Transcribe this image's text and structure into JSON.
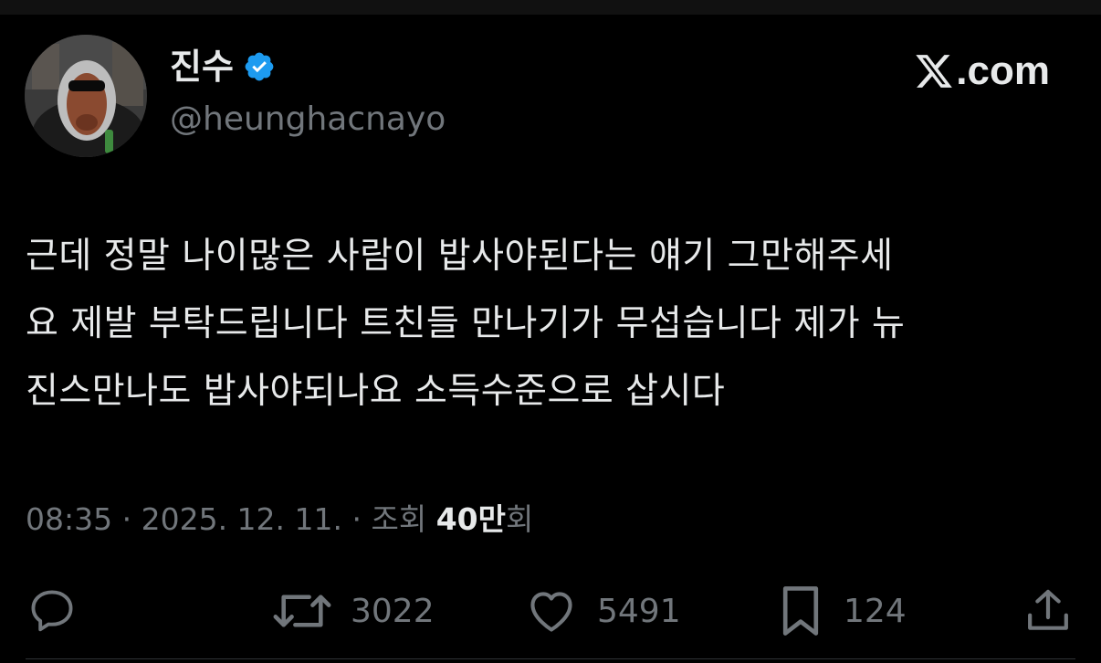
{
  "author": {
    "display_name": "진수",
    "handle": "@heunghacnayo",
    "verified": true
  },
  "brand": {
    "text": ".com"
  },
  "tweet": {
    "lines": [
      "근데 정말 나이많은 사람이 밥사야된다는 얘기 그만해주세",
      "요 제발 부탁드립니다 트친들 만나기가 무섭습니다 제가 뉴",
      "진스만나도 밥사야되나요 소득수준으로 삽시다"
    ]
  },
  "meta": {
    "time": "08:35",
    "sep": " · ",
    "date": "2025. 12. 11.",
    "views_prefix": "조회 ",
    "views_count": "40만",
    "views_suffix": "회"
  },
  "actions": {
    "reply": {
      "icon": "reply-icon"
    },
    "retweet": {
      "icon": "retweet-icon",
      "count": "3022"
    },
    "like": {
      "icon": "heart-icon",
      "count": "5491"
    },
    "bookmark": {
      "icon": "bookmark-icon",
      "count": "124"
    },
    "share": {
      "icon": "share-icon"
    }
  },
  "colors": {
    "background": "#000000",
    "text": "#e7e9ea",
    "secondary": "#71767b",
    "verified": "#1d9bf0"
  }
}
